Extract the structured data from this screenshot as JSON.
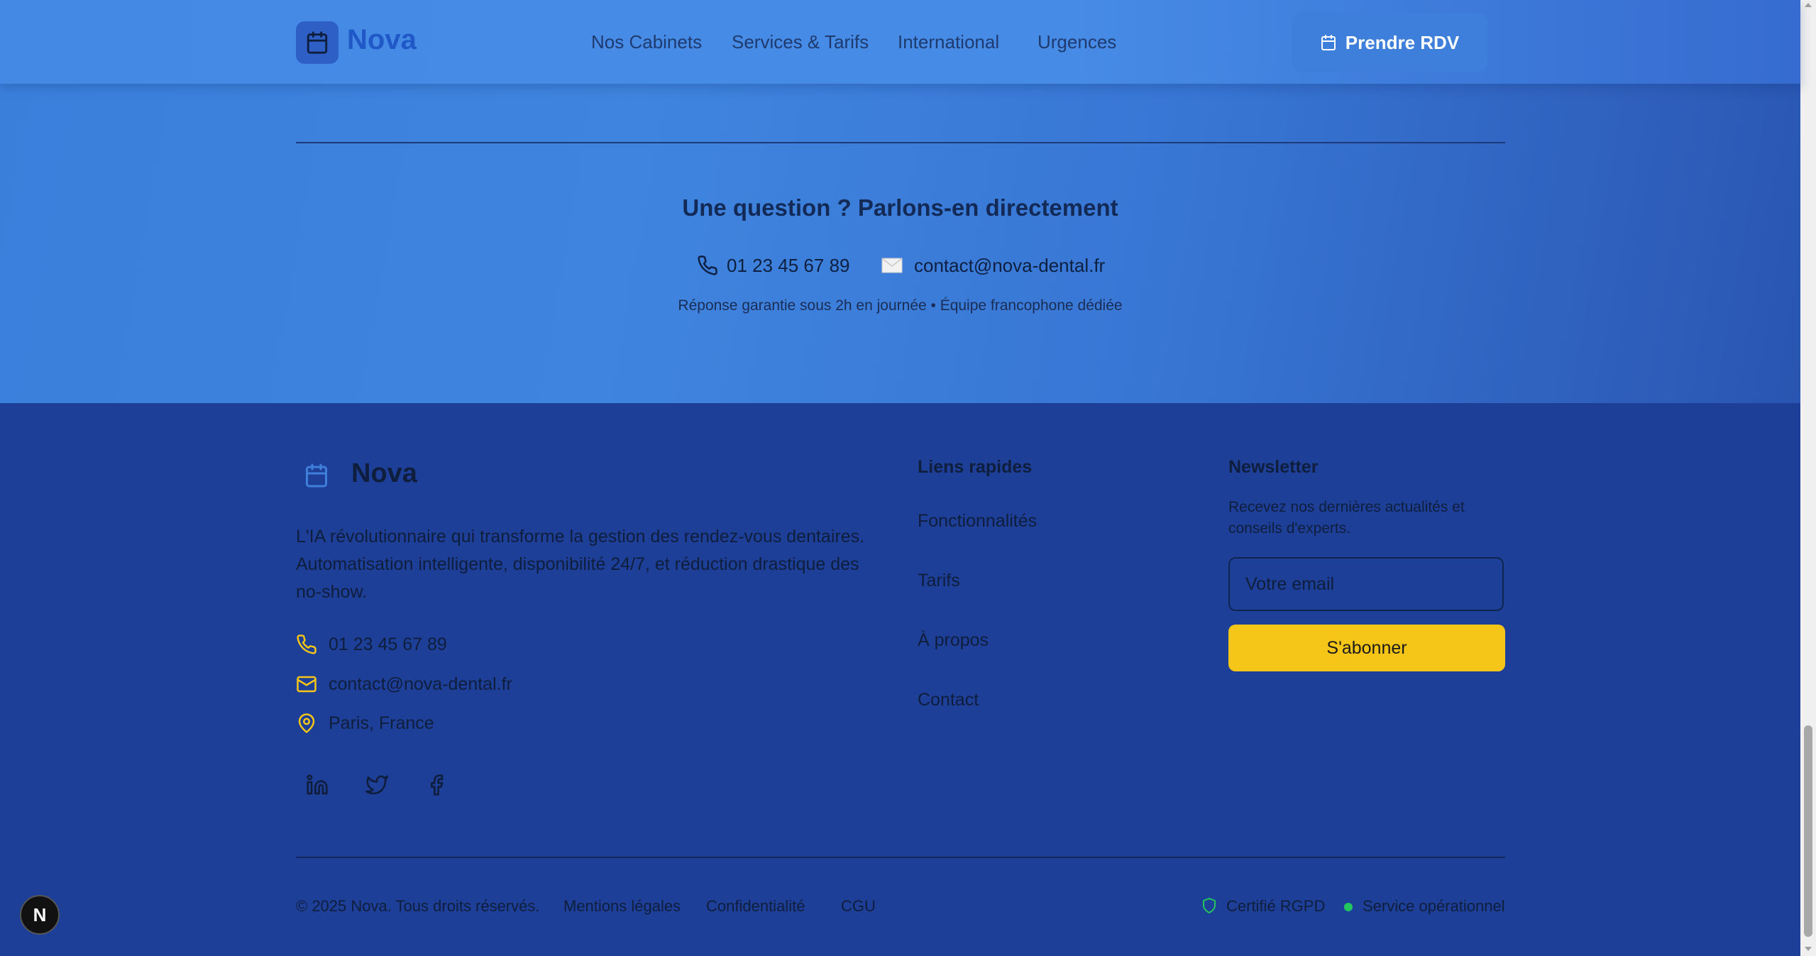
{
  "navbar": {
    "brand": "Nova",
    "links": [
      "Nos Cabinets",
      "Services & Tarifs",
      "International",
      "Urgences"
    ],
    "cta_label": "Prendre RDV"
  },
  "contact_section": {
    "title": "Une question ? Parlons-en directement",
    "phone": "01 23 45 67 89",
    "email": "contact@nova-dental.fr",
    "subtitle": "Réponse garantie sous 2h en journée • Équipe francophone dédiée"
  },
  "footer": {
    "brand": "Nova",
    "description": "L'IA révolutionnaire qui transforme la gestion des rendez-vous dentaires. Automatisation intelligente, disponibilité 24/7, et réduction drastique des no-show.",
    "phone": "01 23 45 67 89",
    "email": "contact@nova-dental.fr",
    "location": "Paris, France",
    "social_icons": [
      "linkedin-icon",
      "twitter-icon",
      "facebook-icon"
    ],
    "quick_links": {
      "title": "Liens rapides",
      "items": [
        "Fonctionnalités",
        "Tarifs",
        "À propos",
        "Contact"
      ]
    },
    "newsletter": {
      "title": "Newsletter",
      "description": "Recevez nos dernières actualités et conseils d'experts.",
      "placeholder": "Votre email",
      "button_label": "S'abonner"
    },
    "bottom": {
      "copyright": "© 2025 Nova. Tous droits réservés.",
      "legal_links": [
        "Mentions légales",
        "Confidentialité",
        "CGU"
      ],
      "rgpd": "Certifié RGPD",
      "status": "Service opérationnel"
    }
  },
  "dev_badge": "N",
  "colors": {
    "accent_yellow": "#f5c518",
    "footer_bg": "#1e3f97",
    "status_green": "#22c55e",
    "primary_blue": "#3d7fdb"
  }
}
